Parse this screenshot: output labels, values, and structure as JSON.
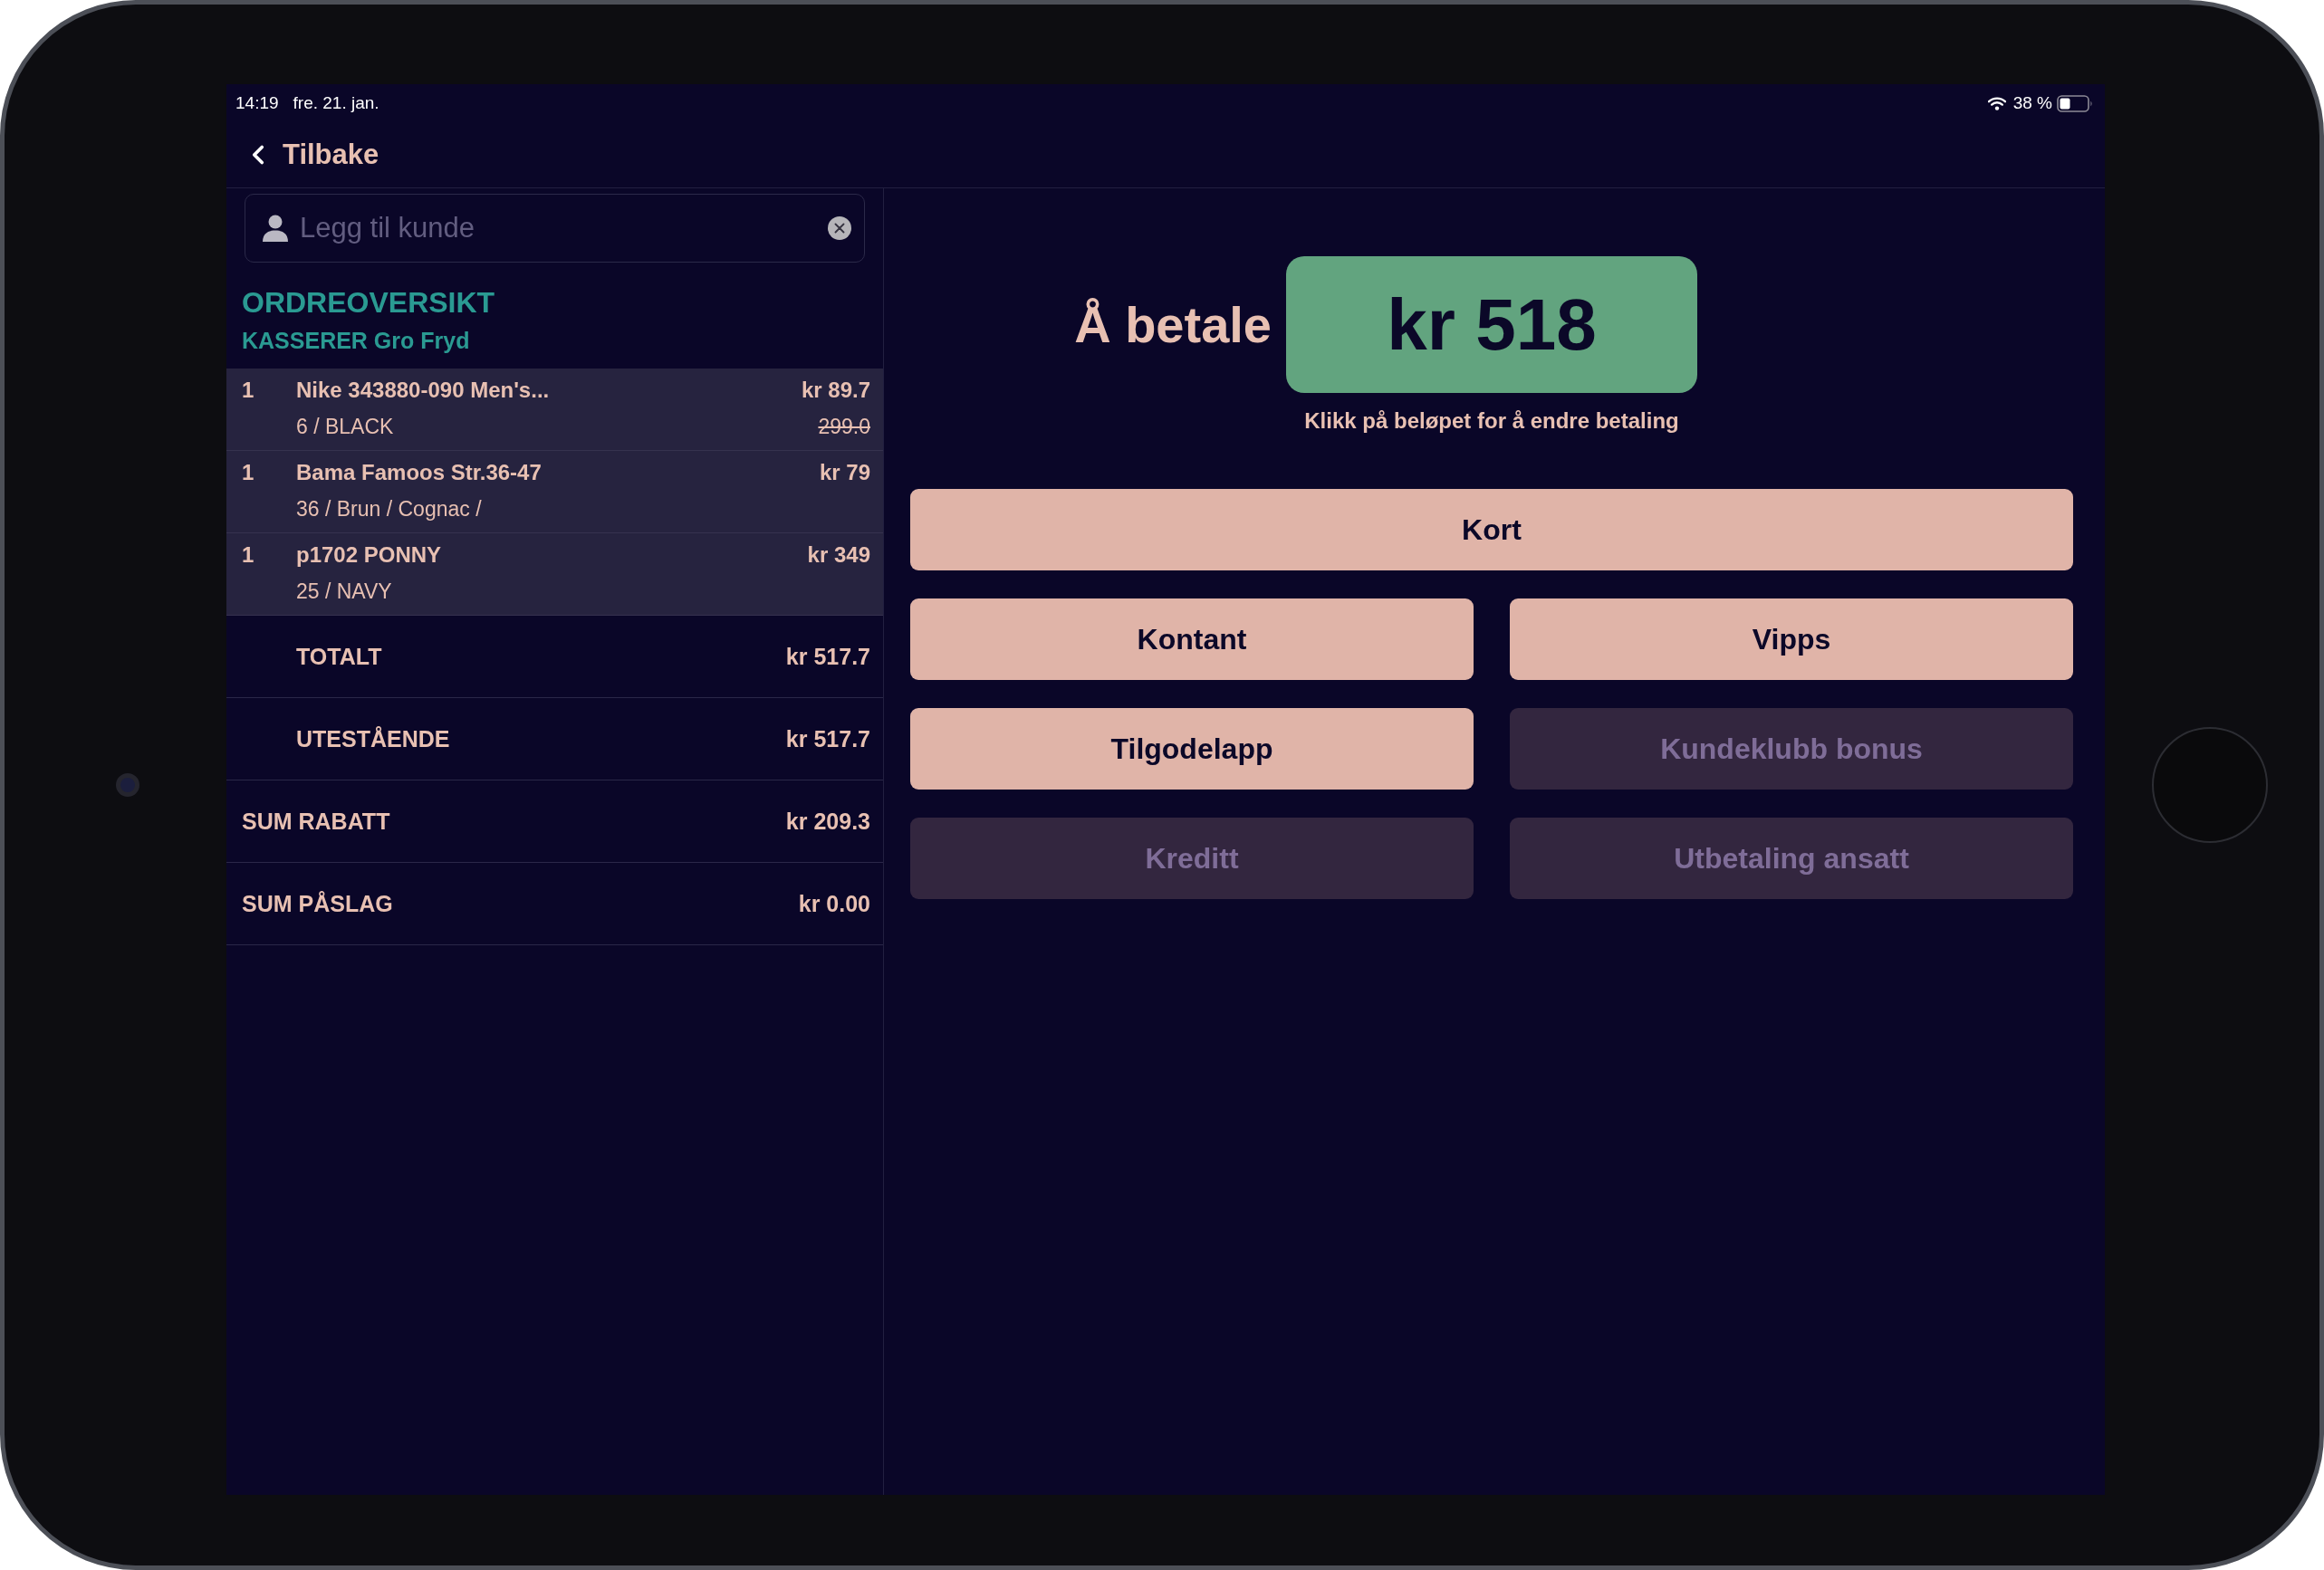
{
  "status_bar": {
    "time": "14:19",
    "date": "fre. 21. jan.",
    "battery": "38 %"
  },
  "header": {
    "back_label": "Tilbake"
  },
  "customer_search": {
    "placeholder": "Legg til kunde"
  },
  "order_overview": {
    "title": "ORDREOVERSIKT",
    "cashier": "KASSERER Gro Fryd",
    "items": [
      {
        "quantity": "1",
        "name": "Nike 343880-090 Men's...",
        "variant": "6 / BLACK",
        "price": "kr 89.7",
        "original_price": "299.0"
      },
      {
        "quantity": "1",
        "name": "Bama Famoos Str.36-47",
        "variant": "36 / Brun / Cognac /",
        "price": "kr 79"
      },
      {
        "quantity": "1",
        "name": "p1702 PONNY",
        "variant": "25 / NAVY",
        "price": "kr 349"
      }
    ],
    "summary": [
      {
        "kind": "total",
        "label": "TOTALT",
        "value": "kr 517.7"
      },
      {
        "kind": "total",
        "label": "UTESTÅENDE",
        "value": "kr 517.7"
      },
      {
        "kind": "adjustment",
        "label": "SUM RABATT",
        "value": "kr 209.3"
      },
      {
        "kind": "adjustment",
        "label": "SUM PÅSLAG",
        "value": "kr 0.00"
      }
    ]
  },
  "payment": {
    "label": "Å betale",
    "amount": "kr 518",
    "hint": "Klikk på beløpet for å endre betaling",
    "method_rows": [
      {
        "methods": [
          {
            "label": "Kort",
            "disabled": false
          }
        ]
      },
      {
        "methods": [
          {
            "label": "Kontant",
            "disabled": false
          },
          {
            "label": "Vipps",
            "disabled": false
          }
        ]
      },
      {
        "methods": [
          {
            "label": "Tilgodelapp",
            "disabled": false
          },
          {
            "label": "Kundeklubb bonus",
            "disabled": true
          }
        ]
      },
      {
        "methods": [
          {
            "label": "Kreditt",
            "disabled": true
          },
          {
            "label": "Utbetaling ansatt",
            "disabled": true
          }
        ]
      }
    ]
  }
}
